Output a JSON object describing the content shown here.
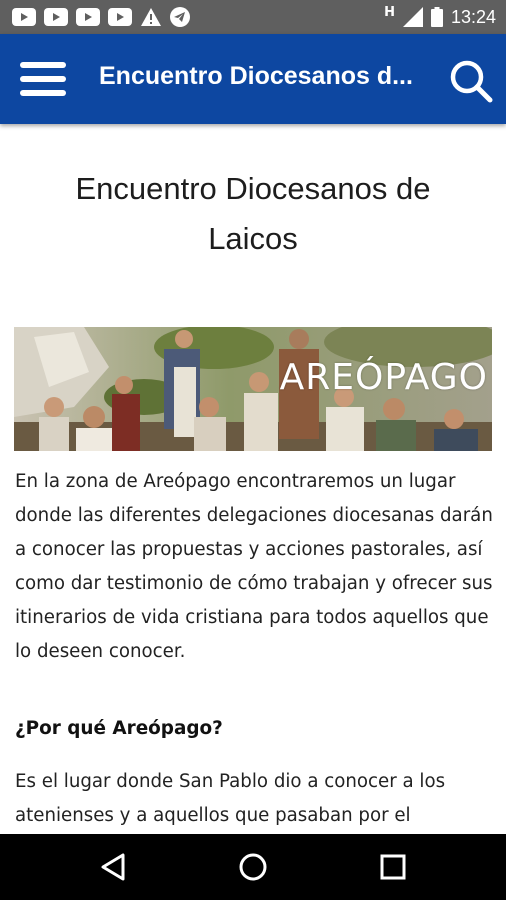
{
  "status_bar": {
    "time": "13:24",
    "network_label": "H",
    "icons": [
      "youtube-icon",
      "youtube-icon",
      "youtube-icon",
      "youtube-icon",
      "warning-icon",
      "telegram-icon",
      "signal-icon",
      "battery-icon"
    ]
  },
  "app_bar": {
    "title": "Encuentro Diocesanos d...",
    "background": "#0d47a1",
    "icons": [
      "menu-icon",
      "search-icon"
    ]
  },
  "article": {
    "title": "Encuentro Diocesanos de Laicos",
    "banner_text": "AREÓPAGO",
    "paragraph1": "En la zona de Areópago encontraremos un lugar donde las diferentes delegaciones diocesanas darán a conocer las propuestas y acciones pastorales, así como dar testimonio de cómo trabajan y ofrecer sus itinerarios de vida cristiana para todos aquellos que lo deseen conocer.",
    "heading": "¿Por qué Areópago?",
    "paragraph2": "Es el lugar donde San Pablo dio a conocer a los atenienses y a aquellos que pasaban por el"
  },
  "nav_bar": {
    "icons": [
      "back-icon",
      "home-icon",
      "recents-icon"
    ]
  }
}
